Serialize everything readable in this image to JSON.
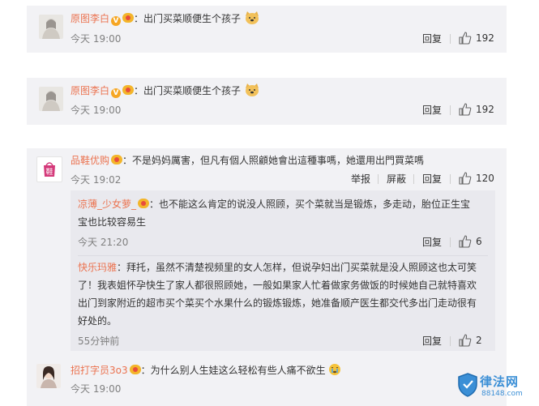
{
  "comments": [
    {
      "user": "原图李白",
      "sep": "：",
      "text": "出门买菜顺便生个孩子",
      "emoji": "doge",
      "time": "今天 19:00",
      "reply": "回复",
      "likes": "192"
    },
    {
      "user": "原图李白",
      "sep": "：",
      "text": "出门买菜顺便生个孩子",
      "emoji": "doge",
      "time": "今天 19:00",
      "reply": "回复",
      "likes": "192"
    }
  ],
  "thread": {
    "user": "品鞋优购",
    "sep": "：",
    "text": "不是妈妈厲害，但凡有個人照顧她會出這種事嗎，她還用出門買菜嗎",
    "time": "今天 19:02",
    "report": "举报",
    "block": "屏蔽",
    "reply": "回复",
    "likes": "120",
    "avatar_char": "鞋",
    "replies": [
      {
        "user": "凉薄_少女萝_",
        "sep": "：",
        "line1": "也不能这么肯定的说没人照顾，买个菜就当是锻炼，多走动，胎位正生宝",
        "line2": "宝也比较容易生",
        "time": "今天 21:20",
        "reply": "回复",
        "likes": "6"
      },
      {
        "user": "快乐玛雅",
        "sep": "：",
        "line1": "拜托，虽然不清楚视频里的女人怎样，但说孕妇出门买菜就是没人照顾这也太可笑",
        "line2": "了！我表姐怀孕快生了家人都很照顾她，一般如果家人忙着做家务做饭的时候她自己就特喜欢",
        "line3": "出门到家附近的超市买个菜买个水果什么的锻炼锻炼，她准备顺产医生都交代多出门走动很有",
        "line4": "好处的。",
        "time": "55分钟前",
        "reply": "回复",
        "likes": "2"
      }
    ]
  },
  "last": {
    "user": "招打字员3o3",
    "sep": "：",
    "text": "为什么别人生娃这么轻松有些人痛不欲生",
    "time": "今天 19:00"
  },
  "watermark": {
    "brand": "律法网",
    "url": "88148.com"
  },
  "colors": {
    "accent": "#eb7350",
    "card": "#f2f2f5"
  }
}
